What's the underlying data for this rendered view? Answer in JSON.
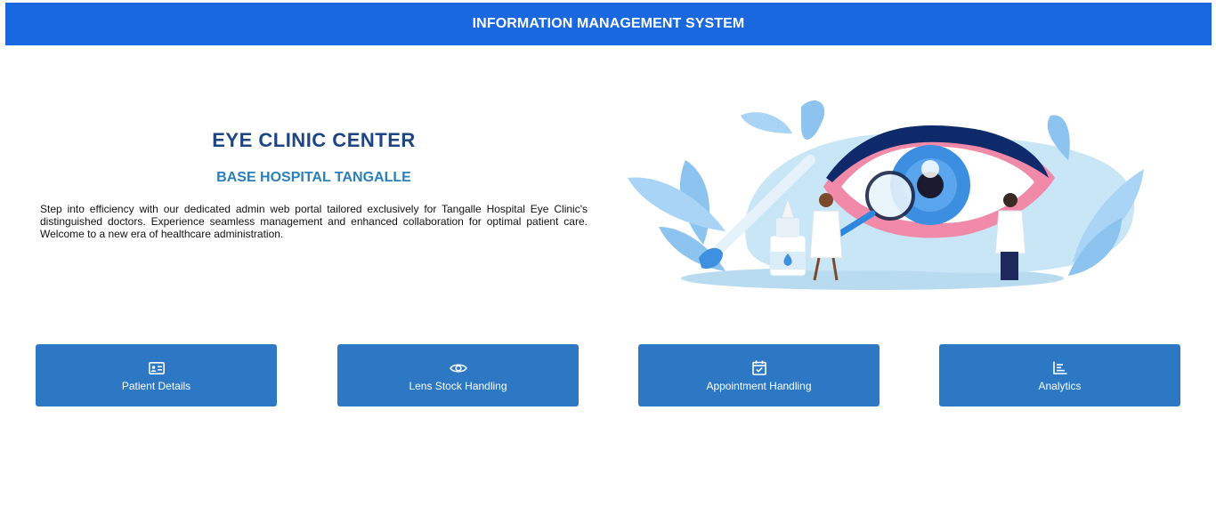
{
  "header": {
    "title": "INFORMATION MANAGEMENT SYSTEM",
    "color": "#1a68df"
  },
  "intro": {
    "clinic_name": "EYE CLINIC CENTER",
    "hospital_name": "BASE HOSPITAL TANGALLE",
    "description": "Step into efficiency with our dedicated admin web portal tailored exclusively for Tangalle Hospital Eye Clinic's distinguished doctors. Experience seamless management and enhanced collaboration for optimal patient care. Welcome to a new era of healthcare administration."
  },
  "illustration": {
    "subject": "eye-examination-illustration"
  },
  "nav": {
    "color": "#2c78c4",
    "items": [
      {
        "label": "Patient Details",
        "icon": "id-card-icon"
      },
      {
        "label": "Lens Stock Handling",
        "icon": "eye-icon"
      },
      {
        "label": "Appointment Handling",
        "icon": "calendar-check-icon"
      },
      {
        "label": "Analytics",
        "icon": "bar-chart-icon"
      }
    ]
  }
}
